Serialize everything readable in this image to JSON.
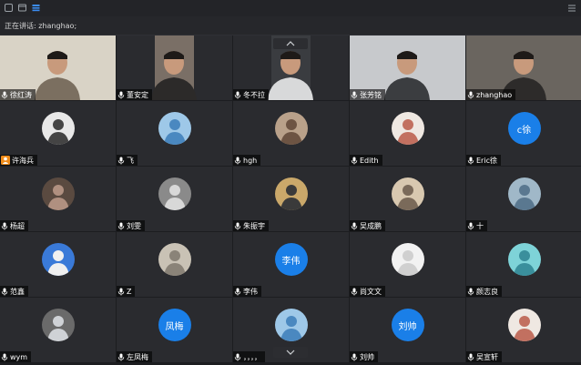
{
  "speaking": {
    "label": "正在讲话:",
    "name": "zhanghao;"
  },
  "icons": {
    "minimize": "minimize-icon",
    "fullscreen": "fullscreen-icon",
    "grid_view": "grid-view-icon",
    "menu": "menu-icon",
    "scroll_up": "chevron-up-icon",
    "scroll_down": "chevron-down-icon"
  },
  "colors": {
    "background": "#1c1d20",
    "tile": "#2a2b2f",
    "active_border": "#2ea86a",
    "text_avatar": "#1a7fe8",
    "host_icon": "#f08c1a"
  },
  "participants": [
    {
      "name": "徐红涛",
      "type": "video"
    },
    {
      "name": "董安定",
      "type": "video"
    },
    {
      "name": "冬不拉",
      "type": "video"
    },
    {
      "name": "张芳铭",
      "type": "video"
    },
    {
      "name": "zhanghao",
      "type": "video",
      "speaking": true
    },
    {
      "name": "许海兵",
      "type": "photo",
      "host": true
    },
    {
      "name": "飞",
      "type": "photo"
    },
    {
      "name": "hgh",
      "type": "photo"
    },
    {
      "name": "Edith",
      "type": "photo"
    },
    {
      "name": "Eric徐",
      "type": "text",
      "avatar_text": "c徐"
    },
    {
      "name": "杨超",
      "type": "photo"
    },
    {
      "name": "刘雯",
      "type": "photo"
    },
    {
      "name": "朱振宇",
      "type": "photo"
    },
    {
      "name": "吴成鹏",
      "type": "photo"
    },
    {
      "name": "十",
      "type": "photo"
    },
    {
      "name": "范鑫",
      "type": "photo"
    },
    {
      "name": "Z",
      "type": "photo"
    },
    {
      "name": "李伟",
      "type": "text",
      "avatar_text": "李伟"
    },
    {
      "name": "尚文文",
      "type": "photo"
    },
    {
      "name": "颜志良",
      "type": "photo"
    },
    {
      "name": "wym",
      "type": "photo"
    },
    {
      "name": "左凤梅",
      "type": "text",
      "avatar_text": "凤梅"
    },
    {
      "name": "，，，，",
      "type": "photo"
    },
    {
      "name": "刘帅",
      "type": "text",
      "avatar_text": "刘帅"
    },
    {
      "name": "吴宣轩",
      "type": "photo"
    }
  ]
}
